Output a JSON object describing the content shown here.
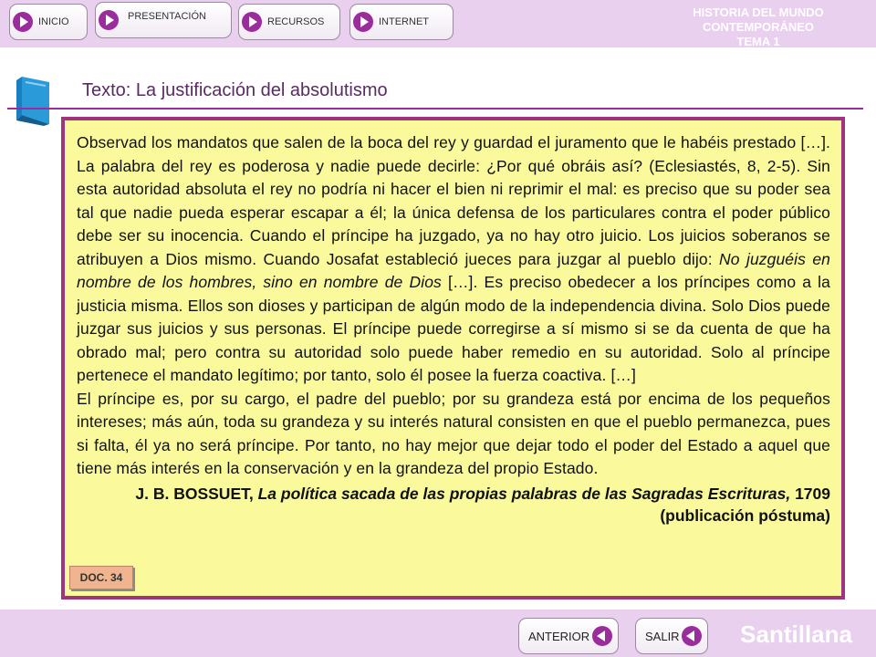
{
  "nav": {
    "inicio": "INICIO",
    "presentacion": "PRESENTACIÓN",
    "recursos": "RECURSOS",
    "internet": "INTERNET"
  },
  "header": {
    "course_line1": "HISTORIA DEL MUNDO CONTEMPORÁNEO",
    "course_line2": "TEMA 1"
  },
  "page": {
    "title": "Texto: La justificación del absolutismo",
    "icon": "book-icon"
  },
  "document": {
    "p1_a": "Observad los mandatos que salen de la boca del rey y guardad el juramento que le habéis prestado […]. La palabra del rey es poderosa y nadie puede decirle: ¿Por qué obráis así? (Eclesiastés, 8, 2-5). Sin esta autoridad absoluta el rey no podría ni hacer el bien ni reprimir el mal: es preciso que su poder sea tal que nadie pueda esperar escapar a él; la única defensa de los particulares contra el poder público debe ser su inocencia. Cuando el príncipe ha juzgado, ya no hay otro juicio. Los juicios soberanos se atribuyen a Dios mismo. Cuando Josafat estableció jueces para juzgar al pueblo dijo: ",
    "p1_italic": "No juzguéis en nombre de los hombres, sino en nombre de Dios",
    "p1_b": " […]. Es preciso obedecer a los príncipes como a la justicia misma. Ellos son dioses y participan de algún modo de la independencia divina. Solo Dios puede juzgar sus juicios y sus personas. El príncipe puede corregirse a sí mismo si se da cuenta de que ha obrado mal; pero contra su autoridad solo puede haber remedio en su autoridad. Solo al príncipe pertenece el mandato legítimo; por tanto, solo él posee la fuerza coactiva. […]",
    "p2": "El príncipe es, por su cargo, el padre del pueblo; por su grandeza está por encima de los pequeños intereses; más aún, toda su grandeza y su interés natural consisten en que el pueblo permanezca, pues si falta, él ya no será príncipe. Por tanto, no hay mejor que dejar todo el poder del Estado a aquel que tiene más interés en la conservación y en la grandeza del propio Estado.",
    "cite_author": "J. B. BOSSUET, ",
    "cite_title": "La política sacada de las propias palabras de las Sagradas Escrituras,",
    "cite_rest": " 1709 (publicación póstuma)",
    "badge": "DOC. 34"
  },
  "footer": {
    "anterior": "ANTERIOR",
    "salir": "SALIR",
    "brand": "Santillana"
  },
  "colors": {
    "accent": "#9b2c9b",
    "bar": "#e8d0ee",
    "doc_border": "#a0357f",
    "doc_bg": "#fafa9c"
  }
}
